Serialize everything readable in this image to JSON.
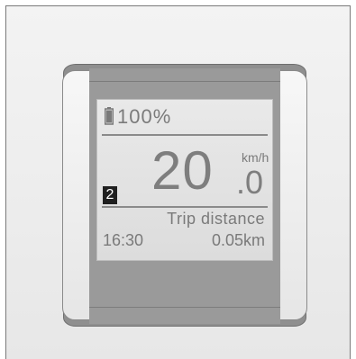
{
  "display": {
    "battery_percent": "100%",
    "speed_integer": "20",
    "speed_decimal": ".0",
    "speed_unit": "km/h",
    "assist_level": "2",
    "trip_label": "Trip distance",
    "clock": "16:30",
    "trip_value": "0.05km"
  },
  "icons": {
    "battery": "battery-full-icon"
  },
  "colors": {
    "lcd_background": "#e2e2e2",
    "lcd_text": "#7a7a7a",
    "device_body": "#8f8f8f",
    "assist_badge": "#1f1f1f"
  }
}
